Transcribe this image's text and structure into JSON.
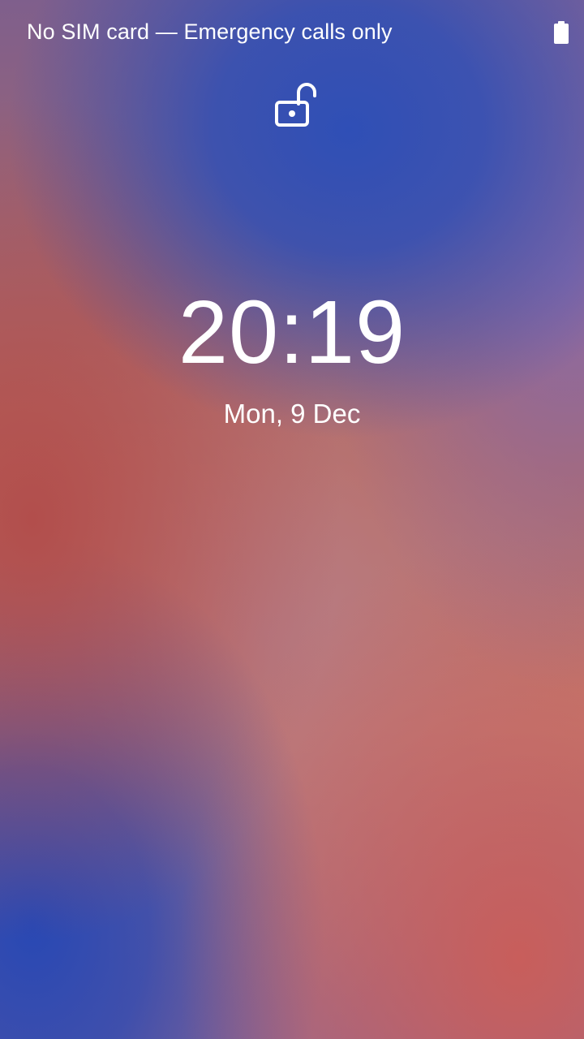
{
  "status_bar": {
    "carrier_text": "No SIM card — Emergency calls only",
    "battery_icon": "battery-full-icon"
  },
  "lockscreen": {
    "lock_icon": "lock-open-icon",
    "time": "20:19",
    "date": "Mon, 9 Dec"
  },
  "colors": {
    "text": "#ffffff",
    "wallpaper_blue": "#2f4fb6",
    "wallpaper_red": "#b24e4c"
  }
}
